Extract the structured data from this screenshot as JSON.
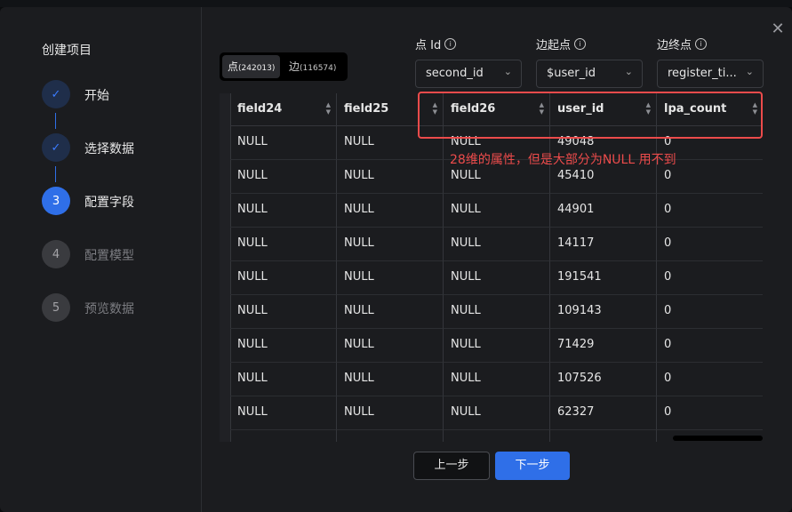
{
  "modal": {
    "title": "创建项目"
  },
  "steps": [
    {
      "number": "",
      "label": "开始",
      "state": "done"
    },
    {
      "number": "",
      "label": "选择数据",
      "state": "done"
    },
    {
      "number": "3",
      "label": "配置字段",
      "state": "active"
    },
    {
      "number": "4",
      "label": "配置模型",
      "state": "todo"
    },
    {
      "number": "5",
      "label": "预览数据",
      "state": "todo"
    }
  ],
  "toggle": {
    "vertex_label": "点",
    "vertex_count": "(242013)",
    "edge_label": "边",
    "edge_count": "(116574)"
  },
  "fields": {
    "vertex_id": {
      "label": "点 Id",
      "value": "second_id"
    },
    "edge_source": {
      "label": "边起点",
      "value": "$user_id"
    },
    "edge_target": {
      "label": "边终点",
      "value": "register_ti..."
    }
  },
  "table": {
    "columns": [
      "field24",
      "field25",
      "field26",
      "user_id",
      "lpa_count"
    ],
    "rows": [
      [
        "NULL",
        "NULL",
        "NULL",
        "49048",
        "0"
      ],
      [
        "NULL",
        "NULL",
        "NULL",
        "45410",
        "0"
      ],
      [
        "NULL",
        "NULL",
        "NULL",
        "44901",
        "0"
      ],
      [
        "NULL",
        "NULL",
        "NULL",
        "14117",
        "0"
      ],
      [
        "NULL",
        "NULL",
        "NULL",
        "191541",
        "0"
      ],
      [
        "NULL",
        "NULL",
        "NULL",
        "109143",
        "0"
      ],
      [
        "NULL",
        "NULL",
        "NULL",
        "71429",
        "0"
      ],
      [
        "NULL",
        "NULL",
        "NULL",
        "107526",
        "0"
      ],
      [
        "NULL",
        "NULL",
        "NULL",
        "62327",
        "0"
      ],
      [
        "",
        "",
        "",
        "",
        ""
      ]
    ]
  },
  "annotation": "28维的属性，但是大部分为NULL 用不到",
  "buttons": {
    "prev": "上一步",
    "next": "下一步"
  },
  "colors": {
    "accent": "#2f6fe8",
    "annotation": "#ec4b4b"
  }
}
